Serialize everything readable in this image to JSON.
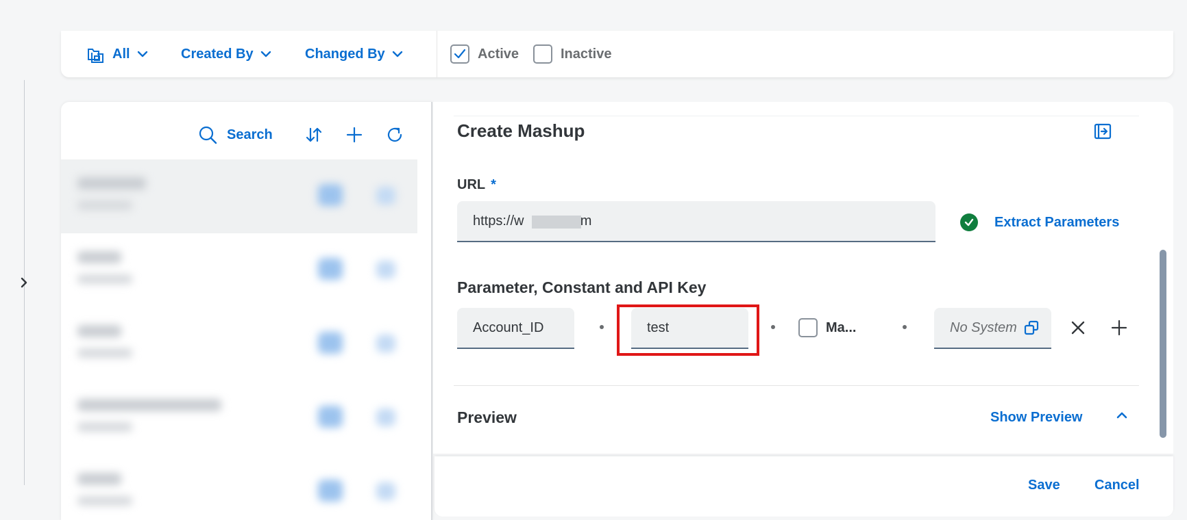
{
  "filter_bar": {
    "all_label": "All",
    "created_by_label": "Created By",
    "changed_by_label": "Changed By",
    "active_label": "Active",
    "active_checked": true,
    "inactive_label": "Inactive",
    "inactive_checked": false
  },
  "list_panel": {
    "search_label": "Search",
    "rows": [
      {
        "selected": true
      },
      {
        "selected": false
      },
      {
        "selected": false
      },
      {
        "selected": false
      },
      {
        "selected": false
      }
    ]
  },
  "detail": {
    "title": "Create Mashup",
    "url_label": "URL",
    "url_required_mark": "*",
    "url_value": "https://w        g.com",
    "extract_label": "Extract Parameters",
    "param_heading": "Parameter, Constant and API Key",
    "param_name": "Account_ID",
    "param_value": "test",
    "mask_label": "Ma...",
    "mask_checked": false,
    "system_placeholder": "No System",
    "preview_label": "Preview",
    "show_preview_label": "Show Preview"
  },
  "footer": {
    "save_label": "Save",
    "cancel_label": "Cancel"
  },
  "colors": {
    "accent": "#0a6ed1",
    "success": "#107e3e",
    "highlight": "#e01717"
  }
}
